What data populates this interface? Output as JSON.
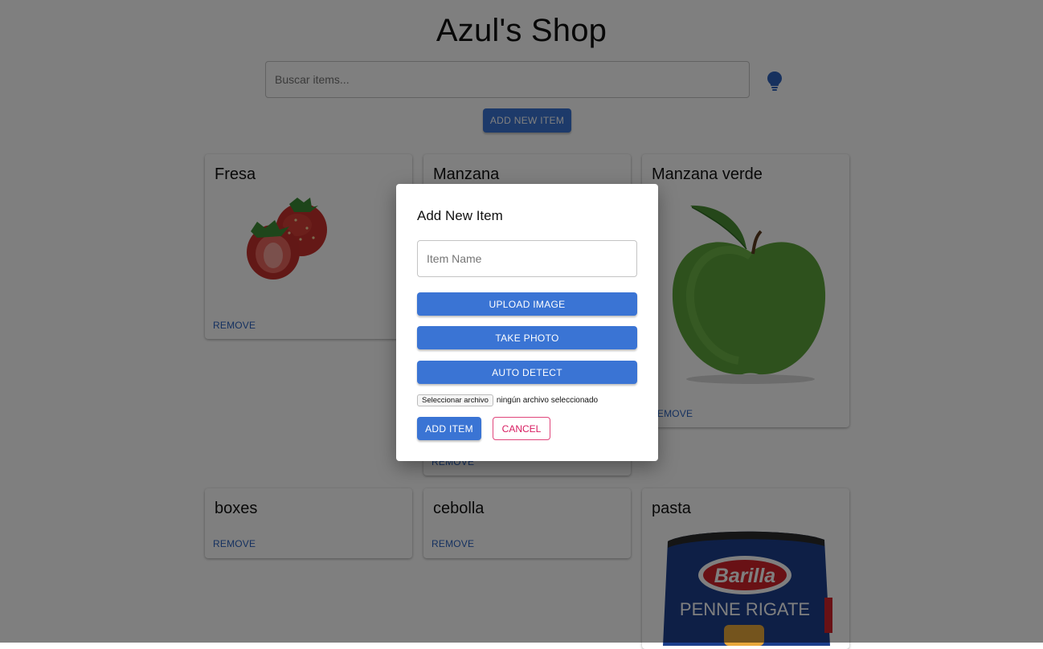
{
  "app": {
    "title": "Azul's Shop"
  },
  "search": {
    "placeholder": "Buscar items..."
  },
  "toolbar": {
    "add_new_label": "ADD NEW ITEM",
    "bulb_icon": "lightbulb-icon"
  },
  "items": [
    {
      "name": "Fresa",
      "remove_label": "REMOVE"
    },
    {
      "name": "Manzana",
      "remove_label": "REMOVE"
    },
    {
      "name": "Manzana verde",
      "remove_label": "REMOVE"
    },
    {
      "name": "boxes",
      "remove_label": "REMOVE"
    },
    {
      "name": "cebolla",
      "remove_label": "REMOVE"
    },
    {
      "name": "pasta",
      "brand": "Barilla",
      "product": "PENNE RIGATE"
    }
  ],
  "dialog": {
    "title": "Add New Item",
    "item_name_placeholder": "Item Name",
    "upload_label": "UPLOAD IMAGE",
    "take_photo_label": "TAKE PHOTO",
    "auto_detect_label": "AUTO DETECT",
    "file_button_label": "Seleccionar archivo",
    "file_status": "ningún archivo seleccionado",
    "add_item_label": "ADD ITEM",
    "cancel_label": "CANCEL"
  },
  "colors": {
    "primary": "#3a74d4",
    "link": "#2b62c0",
    "cancel": "#d81b60"
  }
}
